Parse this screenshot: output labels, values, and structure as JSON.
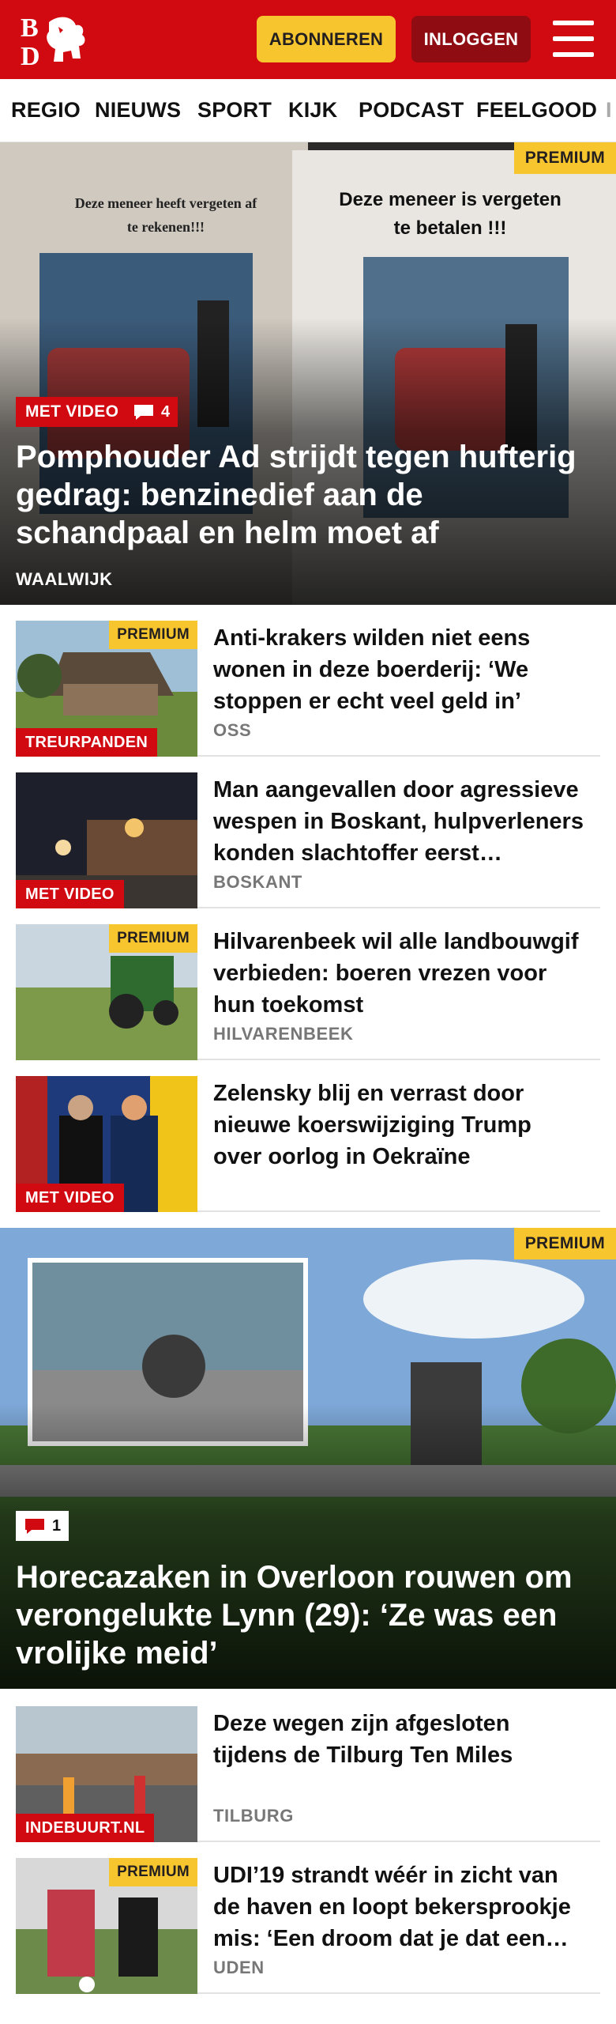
{
  "header": {
    "logo_text": "BD",
    "subscribe_label": "ABONNEREN",
    "login_label": "INLOGGEN"
  },
  "nav": {
    "items": [
      "REGIO",
      "NIEUWS",
      "SPORT",
      "KIJK",
      "PODCAST",
      "FEELGOOD",
      "I"
    ]
  },
  "hero1": {
    "premium_label": "PREMIUM",
    "video_label": "MET VIDEO",
    "comment_count": "4",
    "title": "Pomphouder Ad strijdt tegen hufterig gedrag: benzinedief aan de schandpaal en helm moet af",
    "location": "WAALWIJK",
    "sign_left": "Deze meneer heeft vergeten af te rekenen!!!",
    "sign_right": "Deze meneer is vergeten te betalen !!!"
  },
  "articles1": [
    {
      "title": "Anti-krakers wilden niet eens wonen in deze boerderij: ‘We stoppen er echt veel geld in’",
      "location": "OSS",
      "premium": "PREMIUM",
      "tag": "TREURPANDEN"
    },
    {
      "title": "Man aangevallen door agressieve wespen in Boskant, hulpverleners konden slachtoffer eerst…",
      "location": "BOSKANT",
      "premium": "",
      "tag": "MET VIDEO"
    },
    {
      "title": "Hilvarenbeek wil alle landbouwgif verbieden: boeren vrezen voor hun toekomst",
      "location": "HILVARENBEEK",
      "premium": "PREMIUM",
      "tag": ""
    },
    {
      "title": "Zelensky blij en verrast door nieuwe koerswijziging Trump over oorlog in Oekraïne",
      "location": "",
      "premium": "",
      "tag": "MET VIDEO"
    }
  ],
  "hero2": {
    "premium_label": "PREMIUM",
    "comment_count": "1",
    "title": "Horecazaken in Overloon rouwen om verongelukte Lynn (29): ‘Ze was een vrolijke meid’"
  },
  "articles2": [
    {
      "title": "Deze wegen zijn afgesloten tijdens de Tilburg Ten Miles",
      "location": "TILBURG",
      "premium": "",
      "tag": "INDEBUURT.NL"
    },
    {
      "title": "UDI’19 strandt wéér in zicht van de haven en loopt bekersprookje mis: ‘Een droom dat je dat een…",
      "location": "UDEN",
      "premium": "PREMIUM",
      "tag": ""
    }
  ],
  "colors": {
    "brand_red": "#d10a11",
    "premium_yellow": "#f7c52e",
    "login_dark_red": "#8e0c12"
  },
  "icons": [
    "logo-icon",
    "hamburger-menu-icon",
    "comment-icon"
  ]
}
